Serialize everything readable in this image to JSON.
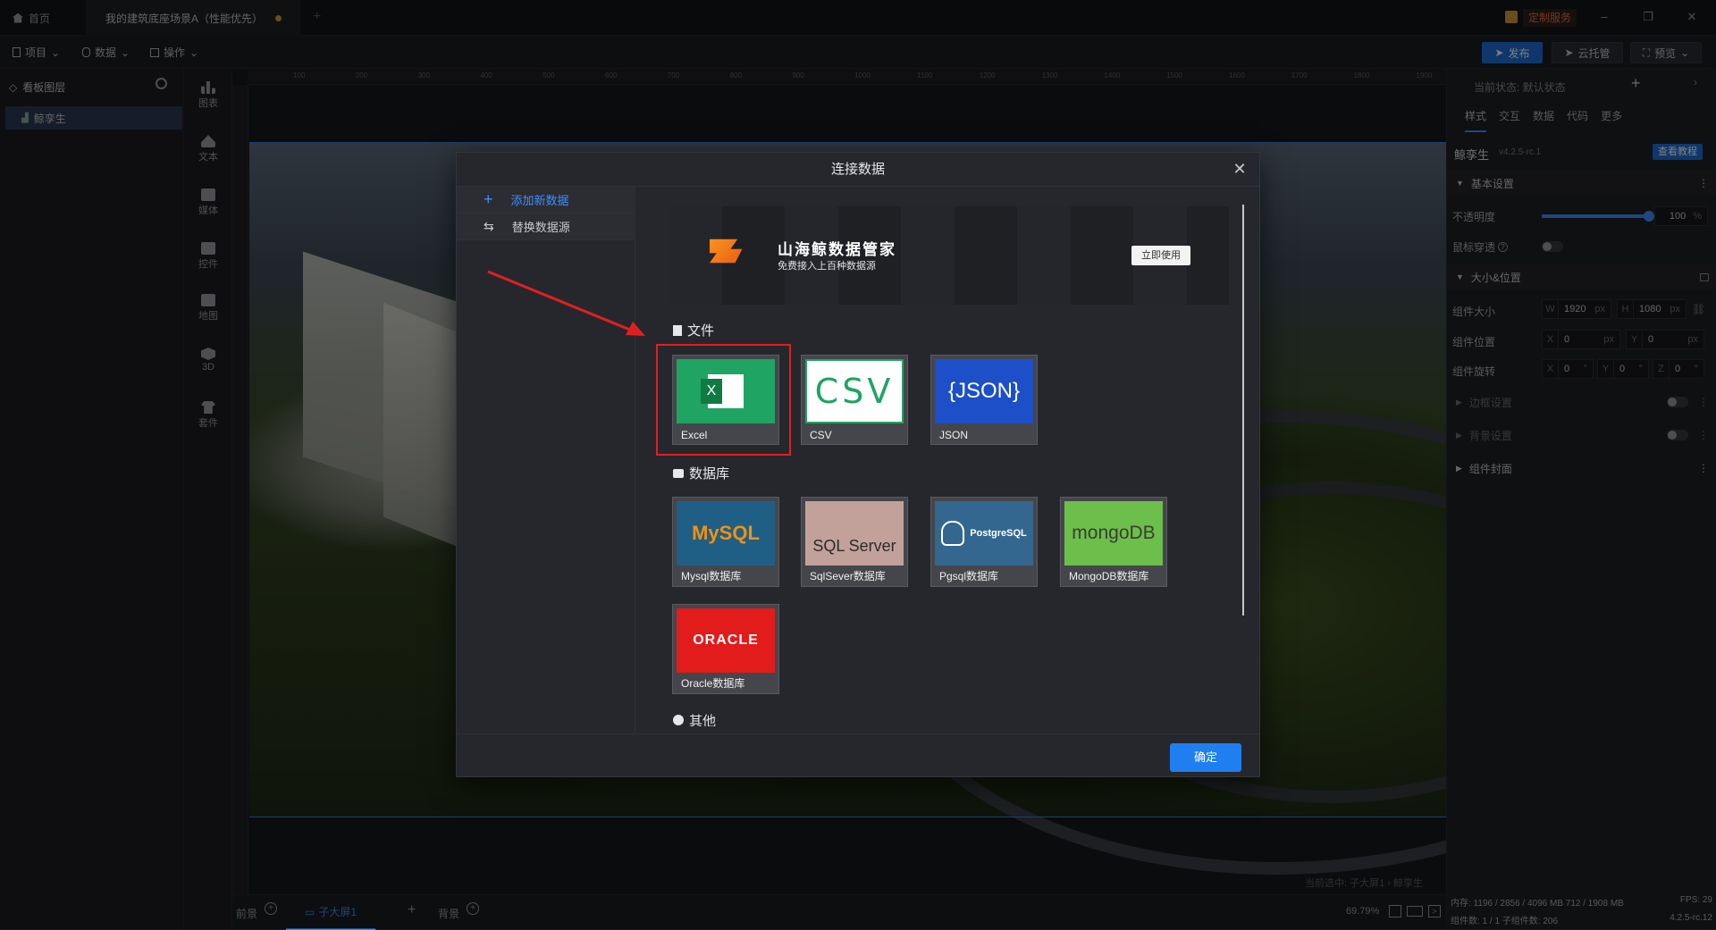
{
  "titlebar": {
    "home_tab": "首页",
    "project_tab": "我的建筑底座场景A（性能优先）",
    "custom_service": "定制服务"
  },
  "menubar": {
    "project": "项目",
    "data": "数据",
    "operate": "操作",
    "publish": "发布",
    "cloud": "云托管",
    "preview": "预览"
  },
  "layers": {
    "title": "看板图层",
    "item": "鲸孪生"
  },
  "tools": [
    "图表",
    "文本",
    "媒体",
    "控件",
    "地图",
    "3D",
    "套件"
  ],
  "ruler_ticks": [
    "100",
    "200",
    "300",
    "400",
    "500",
    "600",
    "700",
    "800",
    "900",
    "1000",
    "1100",
    "1200",
    "1300",
    "1400",
    "1500",
    "1600",
    "1700",
    "1800",
    "1900"
  ],
  "bottombar": {
    "front": "前景",
    "screen": "子大屏1",
    "back": "背景",
    "zoom": "69.79%",
    "breadcrumb": "当前选中: 子大屏1 › 鲸孪生"
  },
  "rightpanel": {
    "state_label": "当前状态: 默认状态",
    "tabs": [
      "样式",
      "交互",
      "数据",
      "代码",
      "更多"
    ],
    "component_name": "鲸孪生",
    "version": "v4.2.5-rc.1",
    "tutorial": "查看教程",
    "basic_settings": "基本设置",
    "opacity_label": "不透明度",
    "opacity_value": "100",
    "opacity_unit": "%",
    "opacity_level": 1.0,
    "mouse_through": "鼠标穿透",
    "size_position": "大小&位置",
    "size_label": "组件大小",
    "size_w": "1920",
    "size_h": "1080",
    "position_label": "组件位置",
    "pos_x": "0",
    "pos_y": "0",
    "rotate_label": "组件旋转",
    "rot_x": "0",
    "rot_y": "0",
    "rot_z": "0",
    "border_settings": "边框设置",
    "bg_settings": "背景设置",
    "cover": "组件封面",
    "memory": "内存: 1196 / 2856 / 4096 MB  712 / 1908 MB",
    "fps": "FPS: 29",
    "component_count": "组件数: 1 / 1  子组件数: 206",
    "build": "4.2.5-rc.12"
  },
  "modal": {
    "title": "连接数据",
    "nav": [
      "添加新数据",
      "替换数据源"
    ],
    "banner_title": "山海鲸数据管家",
    "banner_sub": "免费接入上百种数据源",
    "banner_btn": "立即使用",
    "section_file": "文件",
    "section_db": "数据库",
    "section_other": "其他",
    "files": [
      {
        "label": "Excel",
        "logo": "X",
        "color": "#1fa463"
      },
      {
        "label": "CSV",
        "logo": "CSV",
        "color": "#ffffff"
      },
      {
        "label": "JSON",
        "logo": "{JSON}",
        "color": "#1c4fc8"
      }
    ],
    "databases": [
      {
        "label": "Mysql数据库",
        "logo": "MySQL",
        "color": "#1f5f86"
      },
      {
        "label": "SqlSever数据库",
        "logo": "SQL Server",
        "color": "#c3a19b"
      },
      {
        "label": "Pgsql数据库",
        "logo": "PostgreSQL",
        "color": "#336790"
      },
      {
        "label": "MongoDB数据库",
        "logo": "mongoDB",
        "color": "#6cbf4a"
      },
      {
        "label": "Oracle数据库",
        "logo": "ORACLE",
        "color": "#e21b1b"
      }
    ],
    "confirm": "确定"
  }
}
